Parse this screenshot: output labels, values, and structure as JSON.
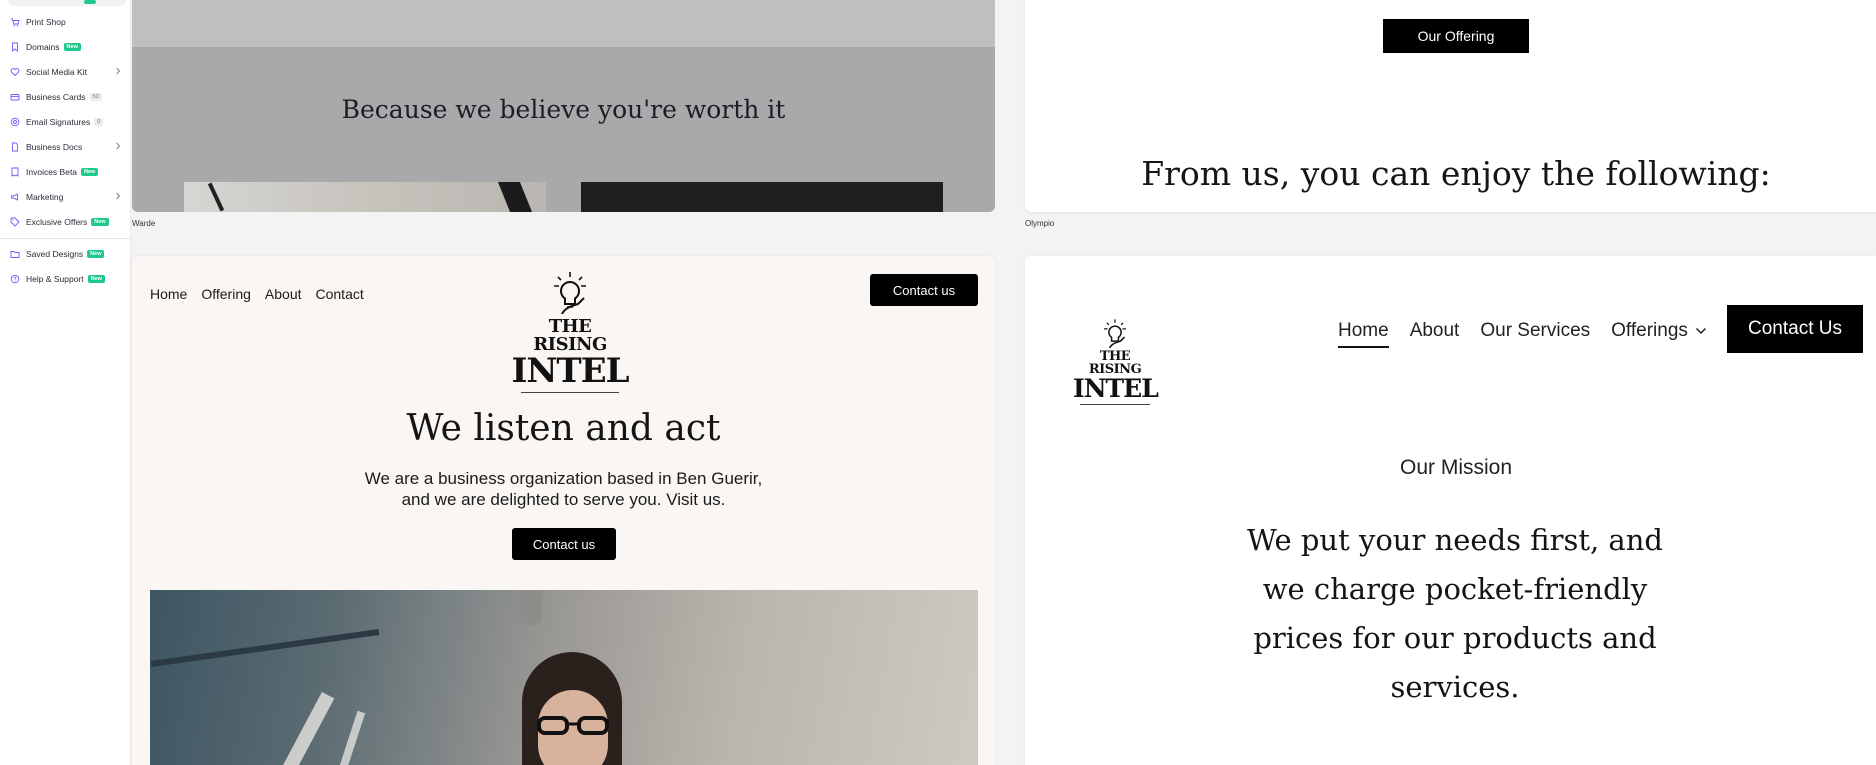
{
  "sidebar": {
    "items": [
      {
        "label": "Print Shop",
        "icon": "cart-icon"
      },
      {
        "label": "Domains",
        "icon": "bookmark-icon",
        "badge": "New"
      },
      {
        "label": "Social Media Kit",
        "icon": "heart-icon",
        "chevron": true
      },
      {
        "label": "Business Cards",
        "icon": "card-icon",
        "badge_gray": "50"
      },
      {
        "label": "Email Signatures",
        "icon": "at-icon",
        "badge_gray": "0"
      },
      {
        "label": "Business Docs",
        "icon": "doc-icon",
        "chevron": true
      },
      {
        "label": "Invoices Beta",
        "icon": "invoice-icon",
        "badge": "New"
      },
      {
        "label": "Marketing",
        "icon": "megaphone-icon",
        "chevron": true
      },
      {
        "label": "Exclusive Offers",
        "icon": "tag-icon",
        "badge": "New"
      },
      {
        "label": "Saved Designs",
        "icon": "folder-icon",
        "badge": "New"
      },
      {
        "label": "Help & Support",
        "icon": "help-icon",
        "badge": "New"
      }
    ],
    "accent": "#1fc98a"
  },
  "templates": {
    "warde": {
      "headline": "Because we believe you're worth it",
      "caption": "Warde"
    },
    "olympio": {
      "button": "Our Offering",
      "headline": "From us, you can enjoy the following:",
      "caption": "Olympio"
    },
    "rising": {
      "nav": [
        "Home",
        "Offering",
        "About",
        "Contact"
      ],
      "contact_top": "Contact us",
      "logo_line1": "THE RISING",
      "logo_line2": "INTEL",
      "headline": "We listen and act",
      "sub_line1": "We are a business organization based in Ben Guerir,",
      "sub_line2": "and we are delighted to serve you. Visit us.",
      "contact_mid": "Contact us"
    },
    "mission": {
      "logo_line1": "THE RISING",
      "logo_line2": "INTEL",
      "nav": [
        "Home",
        "About",
        "Our Services",
        "Offerings"
      ],
      "active_nav": "Home",
      "contact": "Contact Us",
      "label": "Our Mission",
      "text": "We put your needs first, and we charge pocket-friendly prices for our products and services."
    }
  }
}
